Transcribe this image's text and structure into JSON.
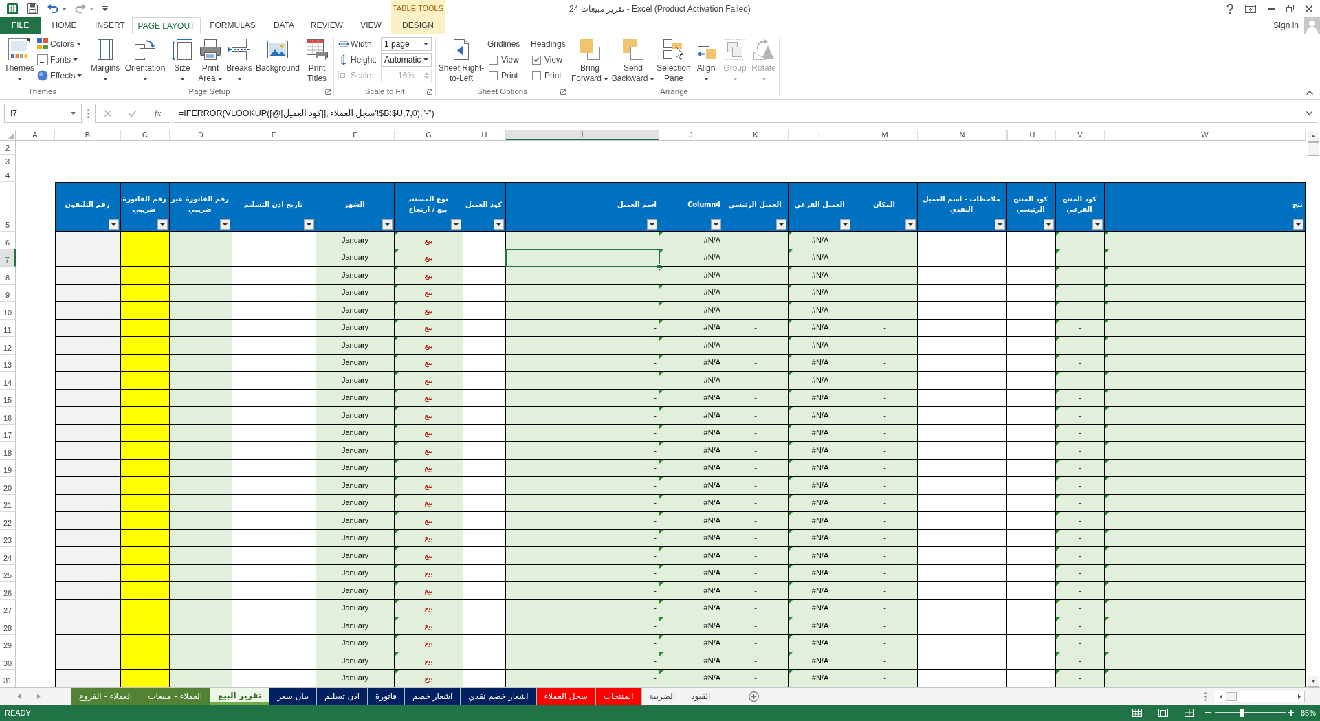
{
  "title_bar": {
    "title": "تقرير مبيعات 24 - Excel (Product Activation Failed)",
    "contextual_group": "TABLE TOOLS"
  },
  "ribbon": {
    "tabs": [
      {
        "label": "DESIGN",
        "kind": "contextual",
        "selected": false
      },
      {
        "label": "VIEW",
        "kind": "standard",
        "selected": false
      },
      {
        "label": "REVIEW",
        "kind": "standard",
        "selected": false
      },
      {
        "label": "DATA",
        "kind": "standard",
        "selected": false
      },
      {
        "label": "FORMULAS",
        "kind": "standard",
        "selected": false
      },
      {
        "label": "PAGE LAYOUT",
        "kind": "standard",
        "selected": true
      },
      {
        "label": "INSERT",
        "kind": "standard",
        "selected": false
      },
      {
        "label": "HOME",
        "kind": "standard",
        "selected": false
      },
      {
        "label": "FILE",
        "kind": "backstage",
        "selected": false
      }
    ],
    "account": "Sign in",
    "themes": {
      "label": "Themes",
      "launcher": false,
      "button": {
        "label": "Themes",
        "dropdown": true
      },
      "options": [
        {
          "label": "Colors",
          "dropdown": true
        },
        {
          "label": "Fonts",
          "dropdown": true
        },
        {
          "label": "Effects",
          "dropdown": true
        }
      ]
    },
    "page_setup": {
      "label": "Page Setup",
      "launcher": true,
      "buttons": [
        {
          "label": "Print Titles",
          "dropdown": false
        },
        {
          "label": "Background",
          "dropdown": false
        },
        {
          "label": "Breaks",
          "dropdown": true
        },
        {
          "label": "Print Area",
          "dropdown": true
        },
        {
          "label": "Size",
          "dropdown": true
        },
        {
          "label": "Orientation",
          "dropdown": true
        },
        {
          "label": "Margins",
          "dropdown": true
        }
      ]
    },
    "scale_to_fit": {
      "label": "Scale to Fit",
      "launcher": true,
      "fields": [
        {
          "label": "Width:",
          "value": "1 page",
          "kind": "dropdown",
          "disabled": false
        },
        {
          "label": "Height:",
          "value": "Automatic",
          "kind": "dropdown",
          "disabled": false
        },
        {
          "label": "Scale:",
          "value": "16%",
          "kind": "spinner",
          "disabled": true
        }
      ]
    },
    "sheet_options": {
      "label": "Sheet Options",
      "launcher": true,
      "button": {
        "label": "Sheet Right-to-Left",
        "dropdown": false
      },
      "sections": [
        {
          "title": "Headings",
          "options": [
            {
              "label": "View",
              "checked": true
            },
            {
              "label": "Print",
              "checked": false
            }
          ]
        },
        {
          "title": "Gridlines",
          "options": [
            {
              "label": "View",
              "checked": false
            },
            {
              "label": "Print",
              "checked": false
            }
          ]
        }
      ]
    },
    "arrange": {
      "label": "Arrange",
      "launcher": false,
      "buttons": [
        {
          "label": "Rotate",
          "dropdown": true,
          "disabled": true
        },
        {
          "label": "Group",
          "dropdown": true,
          "disabled": true
        },
        {
          "label": "Align",
          "dropdown": true,
          "disabled": false
        },
        {
          "label": "Selection Pane",
          "dropdown": false,
          "disabled": false
        },
        {
          "label": "Send Backward",
          "dropdown": true,
          "disabled": false
        },
        {
          "label": "Bring Forward",
          "dropdown": true,
          "disabled": false
        }
      ]
    }
  },
  "formula_bar": {
    "name_box": "I7",
    "function_button": "fx",
    "formula": "=IFERROR(VLOOKUP([@[كود العميل]],'سجل العملاء'!$B:$U,7,0),\"-\")"
  },
  "sheet": {
    "columns": [
      {
        "letter": "W",
        "selected": false,
        "header": "نتج",
        "error_marker": true
      },
      {
        "letter": "V",
        "selected": false,
        "header": "كود المنتج الفرعي",
        "error_marker": true
      },
      {
        "letter": "U",
        "selected": false,
        "header": "كود المنتج الرئيسي",
        "error_marker": false
      },
      {
        "letter": "N",
        "selected": false,
        "header": "ملاحظات - اسم العميل النقدي",
        "error_marker": false
      },
      {
        "letter": "M",
        "selected": false,
        "header": "المكان",
        "error_marker": false
      },
      {
        "letter": "L",
        "selected": false,
        "header": "العميل الفرعي",
        "error_marker": true
      },
      {
        "letter": "K",
        "selected": false,
        "header": "العميل الرئيسي",
        "error_marker": false
      },
      {
        "letter": "J",
        "selected": false,
        "header": "Column4",
        "error_marker": true
      },
      {
        "letter": "I",
        "selected": true,
        "header": "اسم العميل",
        "error_marker": false
      },
      {
        "letter": "H",
        "selected": false,
        "header": "كود العميل",
        "error_marker": false
      },
      {
        "letter": "G",
        "selected": false,
        "header": "نوع المستند بيع / ارتجاع",
        "error_marker": true
      },
      {
        "letter": "F",
        "selected": false,
        "header": "الشهر",
        "error_marker": false
      },
      {
        "letter": "E",
        "selected": false,
        "header": "تاريخ اذن التسليم",
        "error_marker": false
      },
      {
        "letter": "D",
        "selected": false,
        "header": "رقم الفاتورة غير ضريبي",
        "error_marker": false
      },
      {
        "letter": "C",
        "selected": false,
        "header": "رقم الفاتورة ضريبي",
        "error_marker": false
      },
      {
        "letter": "B",
        "selected": false,
        "header": "رقم التليفون",
        "error_marker": false
      },
      {
        "letter": "A",
        "selected": false
      }
    ],
    "blank_rows": [
      {
        "number": "2",
        "selected": false
      },
      {
        "number": "3",
        "selected": false
      },
      {
        "number": "4",
        "selected": false
      }
    ],
    "header_row": {
      "number": "5",
      "selected": false
    },
    "rows": [
      {
        "number": "6",
        "selected": false,
        "cells": {
          "V": "-",
          "M": "-",
          "L": "#N/A",
          "K": "-",
          "J": "#N/A",
          "I": "-",
          "G": "بيع",
          "F": "January"
        }
      },
      {
        "number": "7",
        "selected": true,
        "cells": {
          "V": "-",
          "M": "-",
          "L": "#N/A",
          "K": "-",
          "J": "#N/A",
          "I": "-",
          "G": "بيع",
          "F": "January"
        }
      },
      {
        "number": "8",
        "selected": false,
        "cells": {
          "V": "-",
          "M": "-",
          "L": "#N/A",
          "K": "-",
          "J": "#N/A",
          "I": "-",
          "G": "بيع",
          "F": "January"
        }
      },
      {
        "number": "9",
        "selected": false,
        "cells": {
          "V": "-",
          "M": "-",
          "L": "#N/A",
          "K": "-",
          "J": "#N/A",
          "I": "-",
          "G": "بيع",
          "F": "January"
        }
      },
      {
        "number": "10",
        "selected": false,
        "cells": {
          "V": "-",
          "M": "-",
          "L": "#N/A",
          "K": "-",
          "J": "#N/A",
          "I": "-",
          "G": "بيع",
          "F": "January"
        }
      },
      {
        "number": "11",
        "selected": false,
        "cells": {
          "V": "-",
          "M": "-",
          "L": "#N/A",
          "K": "-",
          "J": "#N/A",
          "I": "-",
          "G": "بيع",
          "F": "January"
        }
      },
      {
        "number": "12",
        "selected": false,
        "cells": {
          "V": "-",
          "M": "-",
          "L": "#N/A",
          "K": "-",
          "J": "#N/A",
          "I": "-",
          "G": "بيع",
          "F": "January"
        }
      },
      {
        "number": "13",
        "selected": false,
        "cells": {
          "V": "-",
          "M": "-",
          "L": "#N/A",
          "K": "-",
          "J": "#N/A",
          "I": "-",
          "G": "بيع",
          "F": "January"
        }
      },
      {
        "number": "14",
        "selected": false,
        "cells": {
          "V": "-",
          "M": "-",
          "L": "#N/A",
          "K": "-",
          "J": "#N/A",
          "I": "-",
          "G": "بيع",
          "F": "January"
        }
      },
      {
        "number": "15",
        "selected": false,
        "cells": {
          "V": "-",
          "M": "-",
          "L": "#N/A",
          "K": "-",
          "J": "#N/A",
          "I": "-",
          "G": "بيع",
          "F": "January"
        }
      },
      {
        "number": "16",
        "selected": false,
        "cells": {
          "V": "-",
          "M": "-",
          "L": "#N/A",
          "K": "-",
          "J": "#N/A",
          "I": "-",
          "G": "بيع",
          "F": "January"
        }
      },
      {
        "number": "17",
        "selected": false,
        "cells": {
          "V": "-",
          "M": "-",
          "L": "#N/A",
          "K": "-",
          "J": "#N/A",
          "I": "-",
          "G": "بيع",
          "F": "January"
        }
      },
      {
        "number": "18",
        "selected": false,
        "cells": {
          "V": "-",
          "M": "-",
          "L": "#N/A",
          "K": "-",
          "J": "#N/A",
          "I": "-",
          "G": "بيع",
          "F": "January"
        }
      },
      {
        "number": "19",
        "selected": false,
        "cells": {
          "V": "-",
          "M": "-",
          "L": "#N/A",
          "K": "-",
          "J": "#N/A",
          "I": "-",
          "G": "بيع",
          "F": "January"
        }
      },
      {
        "number": "20",
        "selected": false,
        "cells": {
          "V": "-",
          "M": "-",
          "L": "#N/A",
          "K": "-",
          "J": "#N/A",
          "I": "-",
          "G": "بيع",
          "F": "January"
        }
      },
      {
        "number": "21",
        "selected": false,
        "cells": {
          "V": "-",
          "M": "-",
          "L": "#N/A",
          "K": "-",
          "J": "#N/A",
          "I": "-",
          "G": "بيع",
          "F": "January"
        }
      },
      {
        "number": "22",
        "selected": false,
        "cells": {
          "V": "-",
          "M": "-",
          "L": "#N/A",
          "K": "-",
          "J": "#N/A",
          "I": "-",
          "G": "بيع",
          "F": "January"
        }
      },
      {
        "number": "23",
        "selected": false,
        "cells": {
          "V": "-",
          "M": "-",
          "L": "#N/A",
          "K": "-",
          "J": "#N/A",
          "I": "-",
          "G": "بيع",
          "F": "January"
        }
      },
      {
        "number": "24",
        "selected": false,
        "cells": {
          "V": "-",
          "M": "-",
          "L": "#N/A",
          "K": "-",
          "J": "#N/A",
          "I": "-",
          "G": "بيع",
          "F": "January"
        }
      },
      {
        "number": "25",
        "selected": false,
        "cells": {
          "V": "-",
          "M": "-",
          "L": "#N/A",
          "K": "-",
          "J": "#N/A",
          "I": "-",
          "G": "بيع",
          "F": "January"
        }
      },
      {
        "number": "26",
        "selected": false,
        "cells": {
          "V": "-",
          "M": "-",
          "L": "#N/A",
          "K": "-",
          "J": "#N/A",
          "I": "-",
          "G": "بيع",
          "F": "January"
        }
      },
      {
        "number": "27",
        "selected": false,
        "cells": {
          "V": "-",
          "M": "-",
          "L": "#N/A",
          "K": "-",
          "J": "#N/A",
          "I": "-",
          "G": "بيع",
          "F": "January"
        }
      },
      {
        "number": "28",
        "selected": false,
        "cells": {
          "V": "-",
          "M": "-",
          "L": "#N/A",
          "K": "-",
          "J": "#N/A",
          "I": "-",
          "G": "بيع",
          "F": "January"
        }
      },
      {
        "number": "29",
        "selected": false,
        "cells": {
          "V": "-",
          "M": "-",
          "L": "#N/A",
          "K": "-",
          "J": "#N/A",
          "I": "-",
          "G": "بيع",
          "F": "January"
        }
      },
      {
        "number": "30",
        "selected": false,
        "cells": {
          "V": "-",
          "M": "-",
          "L": "#N/A",
          "K": "-",
          "J": "#N/A",
          "I": "-",
          "G": "بيع",
          "F": "January"
        }
      },
      {
        "number": "31",
        "selected": false,
        "cells": {
          "V": "-",
          "M": "-",
          "L": "#N/A",
          "K": "-",
          "J": "#N/A",
          "I": "-",
          "G": "بيع",
          "F": "January"
        }
      }
    ]
  },
  "sheet_tabs": [
    {
      "label": "القيود",
      "selected": false
    },
    {
      "label": "الضريبة",
      "selected": false
    },
    {
      "label": "المنتجات",
      "color": "#ff0000",
      "selected": false
    },
    {
      "label": "سجل العملاء",
      "color": "#ff0000",
      "selected": false
    },
    {
      "label": "اشعار خصم نقدي",
      "color": "#002060",
      "selected": false
    },
    {
      "label": "اشعار خصم",
      "color": "#002060",
      "selected": false
    },
    {
      "label": "فاتورة",
      "color": "#002060",
      "selected": false
    },
    {
      "label": "اذن تسليم",
      "color": "#002060",
      "selected": false
    },
    {
      "label": "بيان سعر",
      "color": "#002060",
      "selected": false
    },
    {
      "label": "تقرير البيع",
      "color": "#70ad47",
      "selected": true
    },
    {
      "label": "العملاء - مبيعات",
      "color": "#548235",
      "selected": false
    },
    {
      "label": "العملاء - الفروع",
      "color": "#548235",
      "selected": false
    }
  ],
  "status_bar": {
    "status": "READY",
    "zoom": {
      "level": 0.38,
      "reading": "85%"
    }
  }
}
